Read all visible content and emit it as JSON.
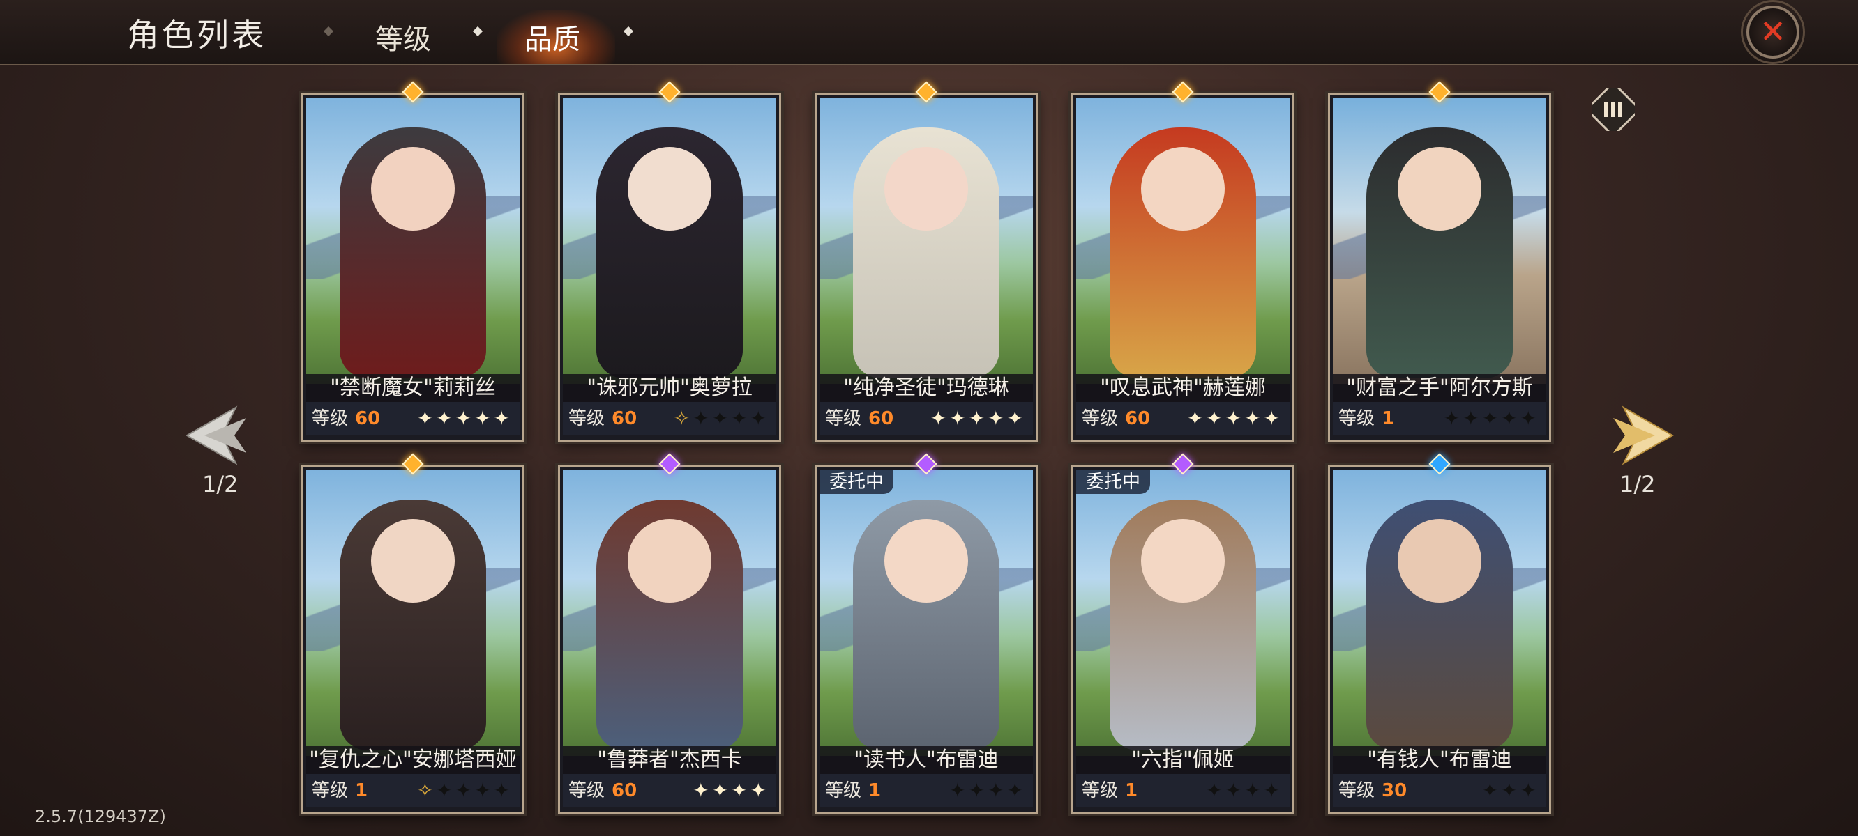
{
  "header": {
    "title": "角色列表",
    "tabs": [
      {
        "label": "等级",
        "active": false
      },
      {
        "label": "品质",
        "active": true
      }
    ],
    "close_icon": "close-icon"
  },
  "pagination": {
    "left": "1/2",
    "right": "1/2"
  },
  "version": "2.5.7(129437Z)",
  "cards": [
    {
      "name": "\"禁断魔女\"莉莉丝",
      "level_label": "等级",
      "level": "60",
      "rarity": "gold",
      "stars": [
        "on",
        "on",
        "on",
        "on",
        "on"
      ],
      "badge": ""
    },
    {
      "name": "\"诛邪元帅\"奥萝拉",
      "level_label": "等级",
      "level": "60",
      "rarity": "gold",
      "stars": [
        "outline",
        "off",
        "off",
        "off",
        "off"
      ],
      "badge": ""
    },
    {
      "name": "\"纯净圣徒\"玛德琳",
      "level_label": "等级",
      "level": "60",
      "rarity": "gold",
      "stars": [
        "on",
        "on",
        "on",
        "on",
        "on"
      ],
      "badge": ""
    },
    {
      "name": "\"叹息武神\"赫莲娜",
      "level_label": "等级",
      "level": "60",
      "rarity": "gold",
      "stars": [
        "on",
        "on",
        "on",
        "on",
        "on"
      ],
      "badge": ""
    },
    {
      "name": "\"财富之手\"阿尔方斯",
      "level_label": "等级",
      "level": "1",
      "rarity": "gold",
      "stars": [
        "off",
        "off",
        "off",
        "off",
        "off"
      ],
      "badge": ""
    },
    {
      "name": "\"复仇之心\"安娜塔西娅",
      "level_label": "等级",
      "level": "1",
      "rarity": "gold",
      "stars": [
        "outline",
        "off",
        "off",
        "off",
        "off"
      ],
      "badge": ""
    },
    {
      "name": "\"鲁莽者\"杰西卡",
      "level_label": "等级",
      "level": "60",
      "rarity": "purple",
      "stars": [
        "on",
        "on",
        "on",
        "on"
      ],
      "badge": ""
    },
    {
      "name": "\"读书人\"布雷迪",
      "level_label": "等级",
      "level": "1",
      "rarity": "purple",
      "stars": [
        "off",
        "off",
        "off",
        "off"
      ],
      "badge": "委托中"
    },
    {
      "name": "\"六指\"佩姬",
      "level_label": "等级",
      "level": "1",
      "rarity": "purple",
      "stars": [
        "off",
        "off",
        "off",
        "off"
      ],
      "badge": "委托中"
    },
    {
      "name": "\"有钱人\"布雷迪",
      "level_label": "等级",
      "level": "30",
      "rarity": "blue",
      "stars": [
        "off",
        "off",
        "off"
      ],
      "badge": ""
    }
  ],
  "colors": {
    "accent_orange": "#ff8a2a",
    "gem_gold": "#ffb22d",
    "gem_purple": "#b35cff",
    "gem_blue": "#2fa7ff"
  }
}
